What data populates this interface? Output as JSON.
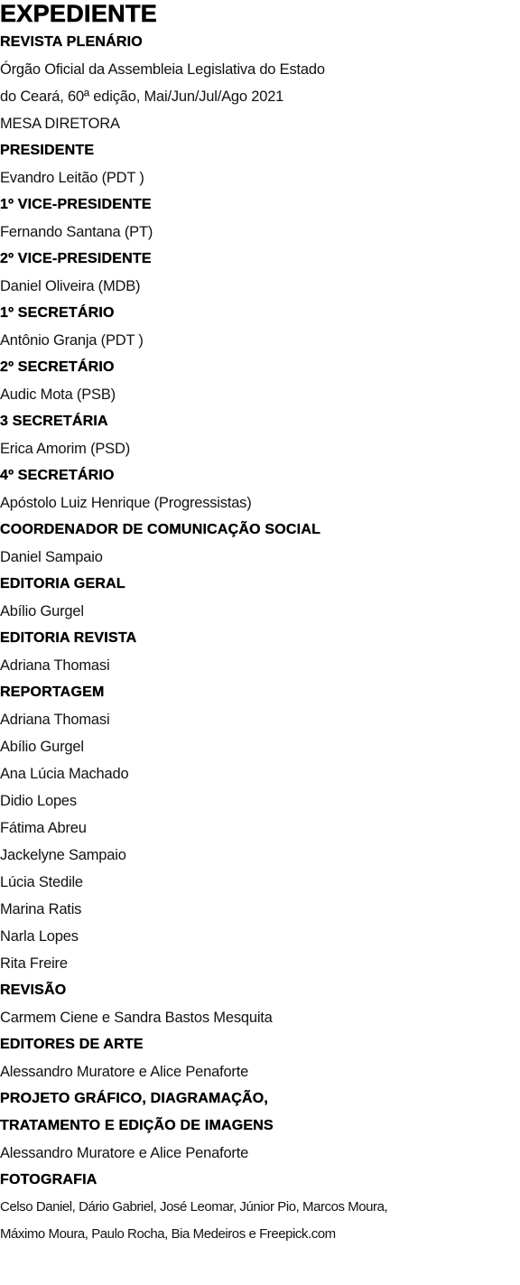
{
  "title": "EXPEDIENTE",
  "lines": [
    {
      "k": "h",
      "text": "REVISTA PLENÁRIO"
    },
    {
      "k": "t",
      "text": "Órgão Oficial da Assembleia Legislativa do Estado"
    },
    {
      "k": "t",
      "text": "do Ceará, 60ª edição, Mai/Jun/Jul/Ago 2021"
    },
    {
      "k": "t",
      "text": "MESA DIRETORA"
    },
    {
      "k": "h",
      "text": "PRESIDENTE"
    },
    {
      "k": "t",
      "text": "Evandro Leitão (PDT )"
    },
    {
      "k": "h",
      "text": "1º VICE-PRESIDENTE"
    },
    {
      "k": "t",
      "text": "Fernando Santana (PT)"
    },
    {
      "k": "h",
      "text": "2º VICE-PRESIDENTE"
    },
    {
      "k": "t",
      "text": "Daniel Oliveira (MDB)"
    },
    {
      "k": "h",
      "text": "1º SECRETÁRIO"
    },
    {
      "k": "t",
      "text": "Antônio Granja (PDT )"
    },
    {
      "k": "h",
      "text": "2º SECRETÁRIO"
    },
    {
      "k": "t",
      "text": "Audic Mota (PSB)"
    },
    {
      "k": "h",
      "text": "3 SECRETÁRIA"
    },
    {
      "k": "t",
      "text": "Erica Amorim (PSD)"
    },
    {
      "k": "h",
      "text": "4º SECRETÁRIO"
    },
    {
      "k": "t",
      "text": "Apóstolo Luiz Henrique (Progressistas)"
    },
    {
      "k": "h",
      "text": "COORDENADOR DE COMUNICAÇÃO SOCIAL"
    },
    {
      "k": "t",
      "text": "Daniel Sampaio"
    },
    {
      "k": "h",
      "text": "EDITORIA GERAL"
    },
    {
      "k": "t",
      "text": "Abílio Gurgel"
    },
    {
      "k": "h",
      "text": "EDITORIA REVISTA"
    },
    {
      "k": "t",
      "text": "Adriana Thomasi"
    },
    {
      "k": "h",
      "text": "REPORTAGEM"
    },
    {
      "k": "t",
      "text": "Adriana Thomasi"
    },
    {
      "k": "t",
      "text": "Abílio Gurgel"
    },
    {
      "k": "t",
      "text": "Ana Lúcia Machado"
    },
    {
      "k": "t",
      "text": "Didio Lopes"
    },
    {
      "k": "t",
      "text": "Fátima Abreu"
    },
    {
      "k": "t",
      "text": "Jackelyne Sampaio"
    },
    {
      "k": "t",
      "text": "Lúcia Stedile"
    },
    {
      "k": "t",
      "text": "Marina Ratis"
    },
    {
      "k": "t",
      "text": "Narla Lopes"
    },
    {
      "k": "t",
      "text": "Rita Freire"
    },
    {
      "k": "h",
      "text": "REVISÃO"
    },
    {
      "k": "t",
      "text": "Carmem Ciene e Sandra Bastos Mesquita"
    },
    {
      "k": "h",
      "text": "EDITORES DE ARTE"
    },
    {
      "k": "t",
      "text": "Alessandro Muratore e Alice Penaforte"
    },
    {
      "k": "h",
      "text": "PROJETO GRÁFICO, DIAGRAMAÇÃO,"
    },
    {
      "k": "h",
      "text": "TRATAMENTO E EDIÇÃO DE IMAGENS"
    },
    {
      "k": "t",
      "text": "Alessandro Muratore e Alice Penaforte"
    },
    {
      "k": "h",
      "text": "FOTOGRAFIA"
    },
    {
      "k": "s",
      "text": "Celso Daniel, Dário Gabriel, José Leomar, Júnior Pio, Marcos Moura,"
    },
    {
      "k": "s",
      "text": "Máximo Moura, Paulo Rocha, Bia Medeiros e Freepick.com"
    }
  ]
}
